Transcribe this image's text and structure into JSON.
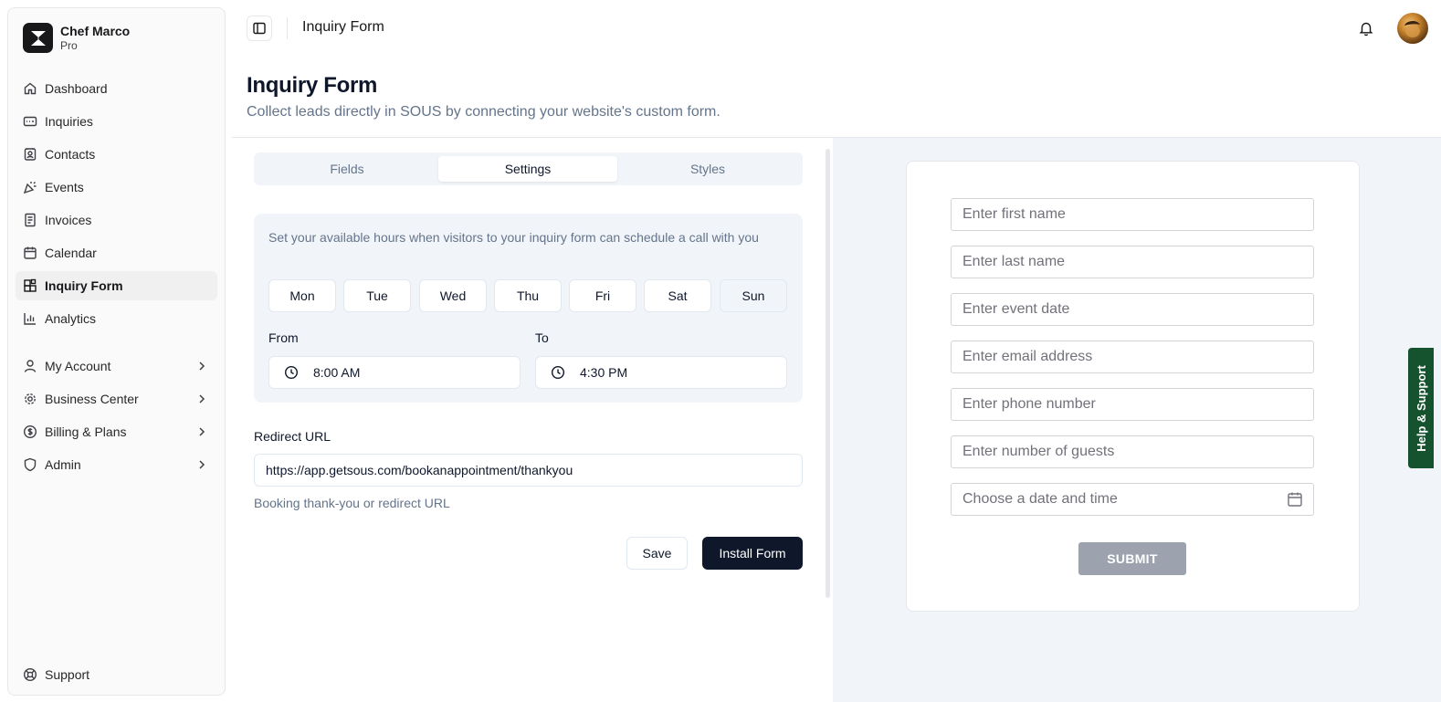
{
  "brand": {
    "name": "Chef Marco",
    "plan": "Pro"
  },
  "nav": [
    {
      "label": "Dashboard",
      "icon": "home-icon"
    },
    {
      "label": "Inquiries",
      "icon": "inbox-icon"
    },
    {
      "label": "Contacts",
      "icon": "contact-book-icon"
    },
    {
      "label": "Events",
      "icon": "party-popper-icon"
    },
    {
      "label": "Invoices",
      "icon": "receipt-icon"
    },
    {
      "label": "Calendar",
      "icon": "calendar-icon"
    },
    {
      "label": "Inquiry Form",
      "icon": "form-blocks-icon",
      "active": true
    },
    {
      "label": "Analytics",
      "icon": "bar-chart-icon"
    }
  ],
  "nav_secondary": [
    {
      "label": "My Account",
      "icon": "user-icon"
    },
    {
      "label": "Business Center",
      "icon": "settings-gear-icon"
    },
    {
      "label": "Billing & Plans",
      "icon": "dollar-circle-icon"
    },
    {
      "label": "Admin",
      "icon": "shield-icon"
    }
  ],
  "support_label": "Support",
  "topbar": {
    "title": "Inquiry Form"
  },
  "page": {
    "title": "Inquiry Form",
    "subtitle": "Collect leads directly in SOUS by connecting your website's custom form."
  },
  "tabs": [
    {
      "label": "Fields"
    },
    {
      "label": "Settings",
      "active": true
    },
    {
      "label": "Styles"
    }
  ],
  "hours": {
    "description": "Set your available hours when visitors to your inquiry form can schedule a call with you",
    "days": [
      "Mon",
      "Tue",
      "Wed",
      "Thu",
      "Fri",
      "Sat",
      "Sun"
    ],
    "selected_day": "Sun",
    "from_label": "From",
    "from_value": "8:00 AM",
    "to_label": "To",
    "to_value": "4:30 PM"
  },
  "redirect": {
    "label": "Redirect URL",
    "value": "https://app.getsous.com/bookanappointment/thankyou",
    "help": "Booking thank-you or redirect URL"
  },
  "actions": {
    "save": "Save",
    "install": "Install Form"
  },
  "preview": {
    "fields": [
      "Enter first name",
      "Enter last name",
      "Enter event date",
      "Enter email address",
      "Enter phone number",
      "Enter number of guests",
      "Choose a date and time"
    ],
    "submit": "SUBMIT"
  },
  "help_tab": "Help & Support",
  "colors": {
    "primary": "#0f172a",
    "help_tab": "#14532d",
    "submit_disabled": "#9ca3af"
  }
}
